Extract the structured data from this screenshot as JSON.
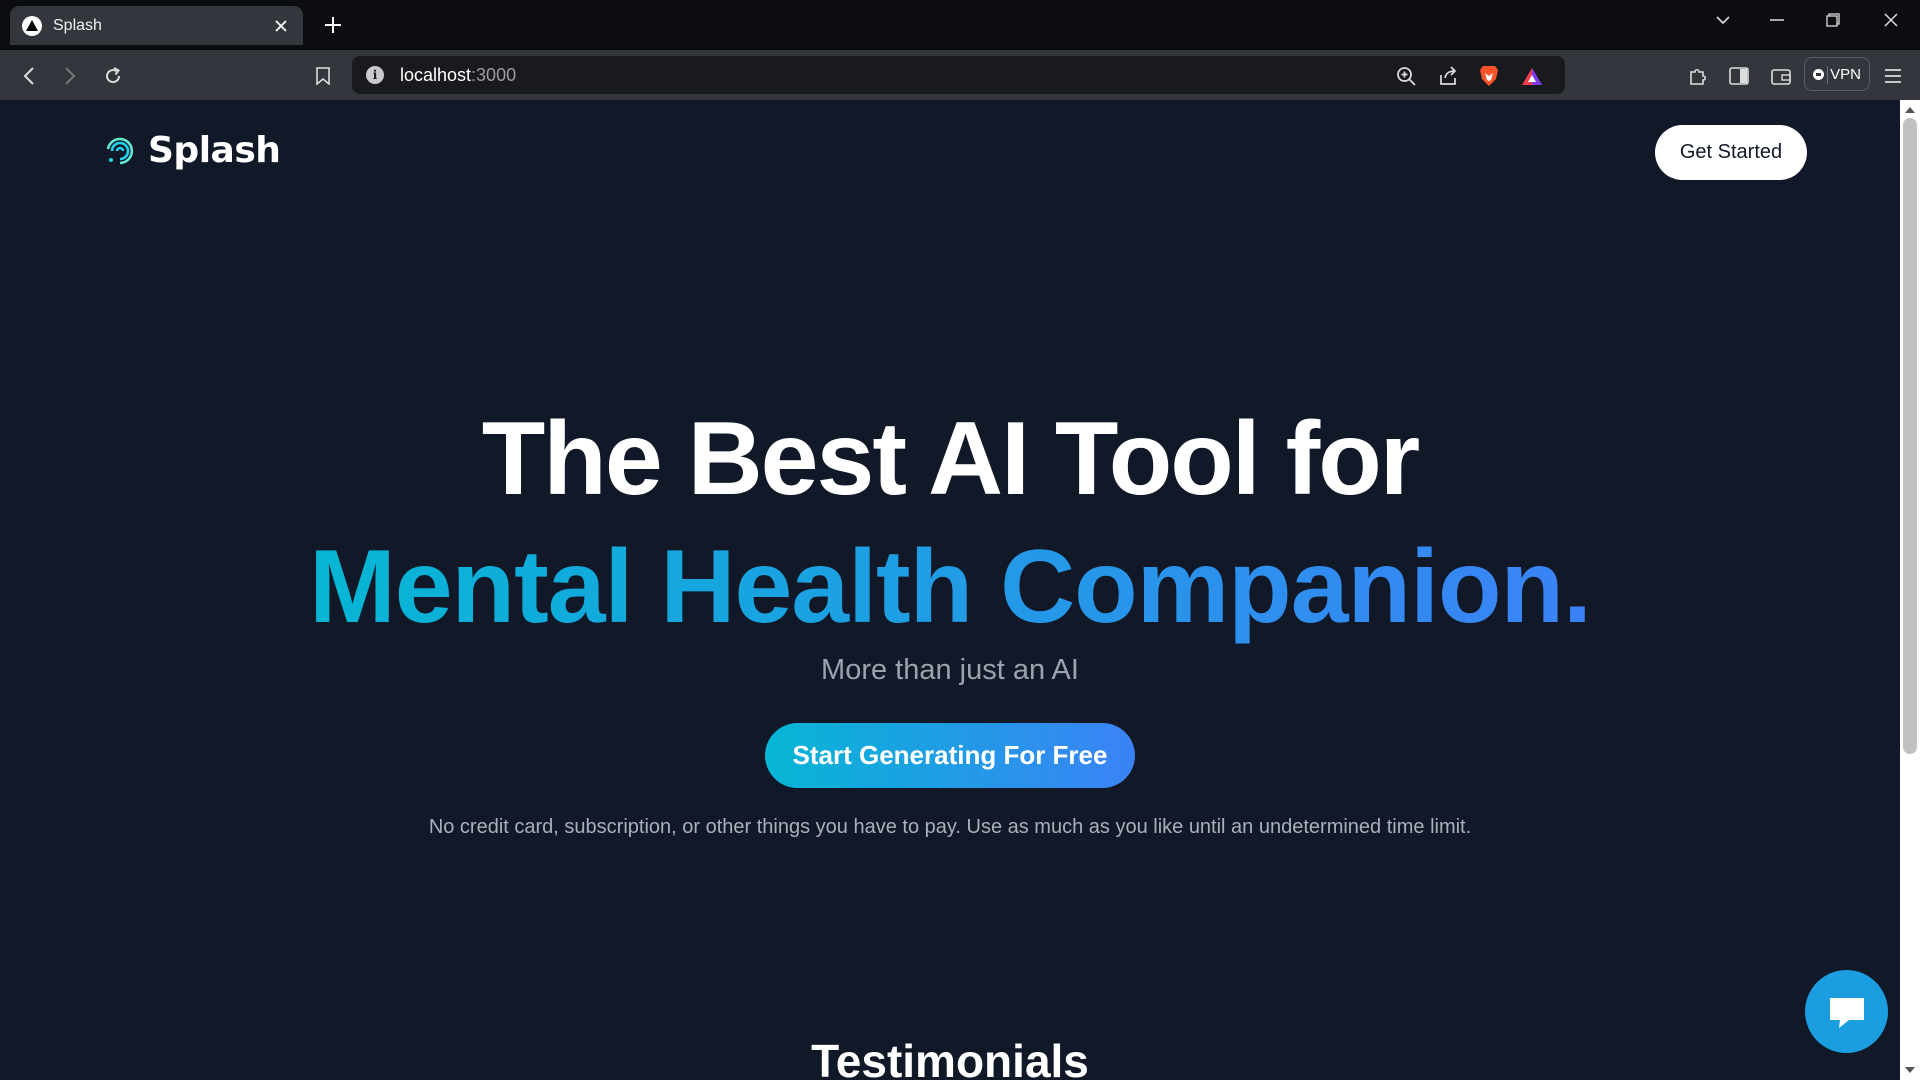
{
  "browser": {
    "tab_title": "Splash",
    "url_host": "localhost",
    "url_port": ":3000",
    "vpn_label": "VPN"
  },
  "site": {
    "logo_text": "Splash",
    "get_started_label": "Get Started"
  },
  "hero": {
    "line1": "The Best AI Tool for",
    "line2": "Mental Health Companion.",
    "subtitle": "More than just an AI",
    "cta_label": "Start Generating For Free",
    "disclaimer": "No credit card, subscription, or other things you have to pay. Use as much as you like until an undetermined time limit."
  },
  "sections": {
    "testimonials_heading": "Testimonials"
  },
  "colors": {
    "page_bg": "#111827",
    "gradient_start": "#06b6d4",
    "gradient_end": "#3b82f6",
    "chat_bubble": "#1a9ee0"
  },
  "icons": [
    "splash-logo-icon",
    "chat-icon",
    "brave-lion-icon",
    "bat-rewards-icon",
    "vpn-shield-icon"
  ]
}
